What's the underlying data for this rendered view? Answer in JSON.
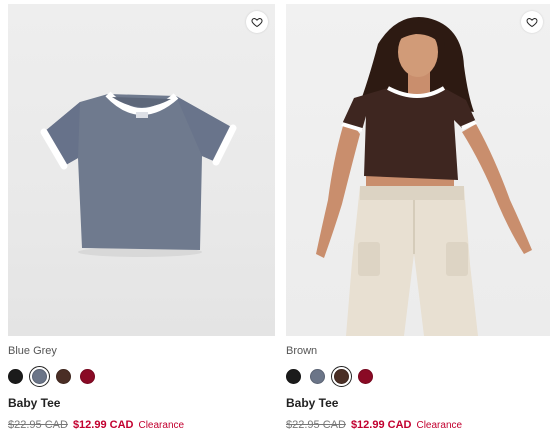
{
  "products": [
    {
      "color_name": "Blue Grey",
      "name": "Baby Tee",
      "original_price": "$22.95 CAD",
      "sale_price": "$12.99 CAD",
      "flag": "Clearance",
      "swatches": [
        {
          "color": "#1b1b1b",
          "selected": false
        },
        {
          "color": "#6b7588",
          "selected": true
        },
        {
          "color": "#4a2e25",
          "selected": false
        },
        {
          "color": "#8a0a25",
          "selected": false
        }
      ]
    },
    {
      "color_name": "Brown",
      "name": "Baby Tee",
      "original_price": "$22.95 CAD",
      "sale_price": "$12.99 CAD",
      "flag": "Clearance",
      "swatches": [
        {
          "color": "#1b1b1b",
          "selected": false
        },
        {
          "color": "#6b7588",
          "selected": false
        },
        {
          "color": "#4a2e25",
          "selected": true
        },
        {
          "color": "#8a0a25",
          "selected": false
        }
      ]
    }
  ],
  "icons": {
    "wishlist": "heart-icon"
  },
  "colors": {
    "sale": "#c2002f",
    "tee_grey": "#6f7a8e",
    "tee_brown": "#3e2620",
    "pants": "#e8e0d2"
  }
}
